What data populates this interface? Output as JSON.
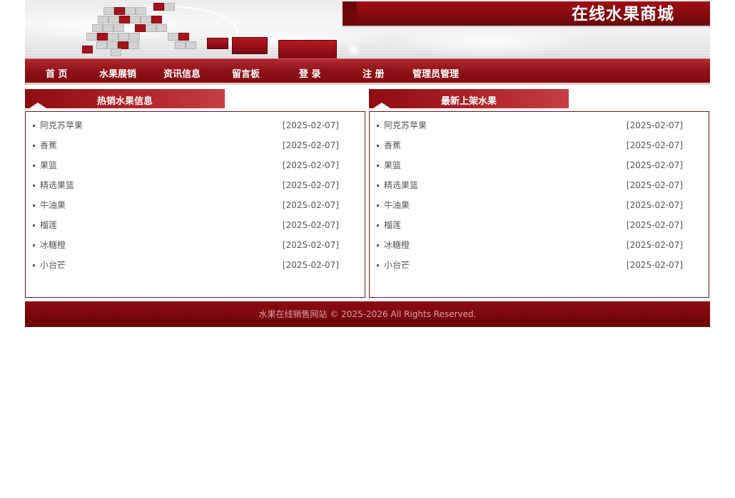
{
  "header": {
    "site_title": "在线水果商城"
  },
  "nav": {
    "items": [
      "首 页",
      "水果展销",
      "资讯信息",
      "留言板",
      "登 录",
      "注 册",
      "管理员管理"
    ]
  },
  "panels": {
    "hot": {
      "title": "热销水果信息",
      "items": [
        {
          "name": "阿克苏苹果",
          "date": "[2025-02-07]"
        },
        {
          "name": "香蕉",
          "date": "[2025-02-07]"
        },
        {
          "name": "果篮",
          "date": "[2025-02-07]"
        },
        {
          "name": "精选果篮",
          "date": "[2025-02-07]"
        },
        {
          "name": "牛油果",
          "date": "[2025-02-07]"
        },
        {
          "name": "榴莲",
          "date": "[2025-02-07]"
        },
        {
          "name": "冰糖橙",
          "date": "[2025-02-07]"
        },
        {
          "name": "小台芒",
          "date": "[2025-02-07]"
        }
      ]
    },
    "new": {
      "title": "最新上架水果",
      "items": [
        {
          "name": "阿克苏苹果",
          "date": "[2025-02-07]"
        },
        {
          "name": "香蕉",
          "date": "[2025-02-07]"
        },
        {
          "name": "果篮",
          "date": "[2025-02-07]"
        },
        {
          "name": "精选果篮",
          "date": "[2025-02-07]"
        },
        {
          "name": "牛油果",
          "date": "[2025-02-07]"
        },
        {
          "name": "榴莲",
          "date": "[2025-02-07]"
        },
        {
          "name": "冰糖橙",
          "date": "[2025-02-07]"
        },
        {
          "name": "小台芒",
          "date": "[2025-02-07]"
        }
      ]
    }
  },
  "footer": {
    "text": "水果在线销售网站  © 2025-2026 All Rights Reserved."
  },
  "colors": {
    "brand_red": "#8d0c12",
    "nav_text": "#ffffff",
    "body_text": "#555555"
  }
}
